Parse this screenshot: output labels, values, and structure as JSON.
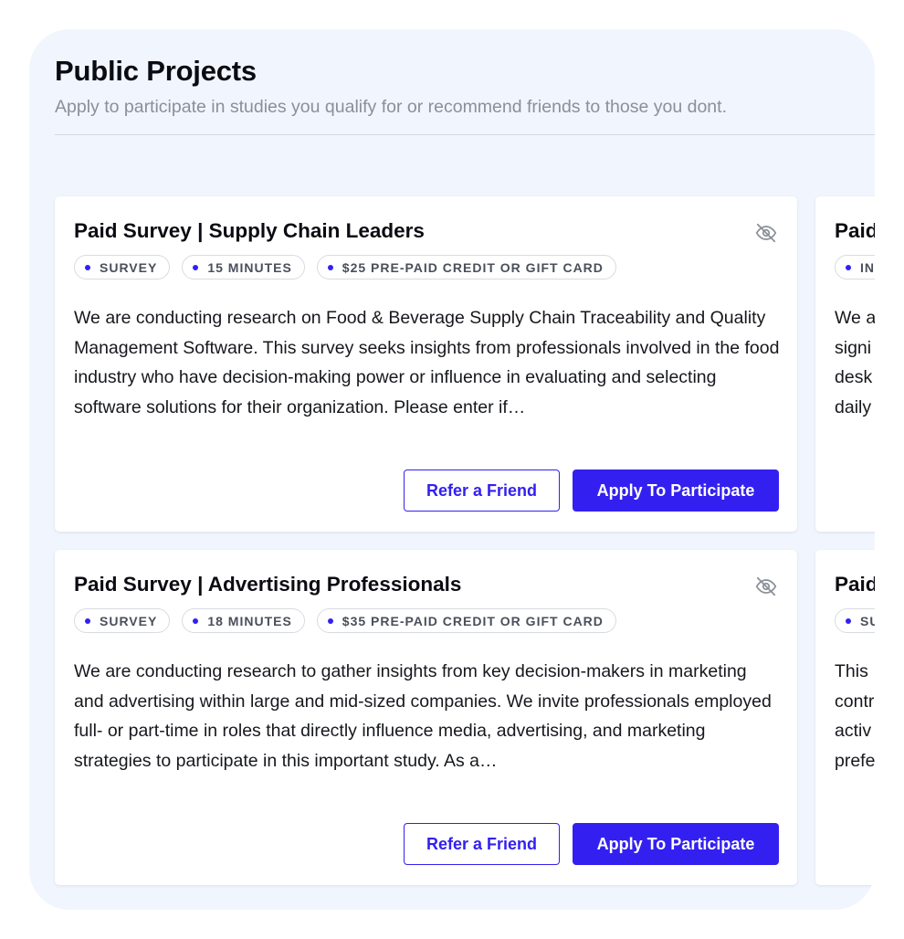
{
  "page": {
    "title": "Public Projects",
    "subtitle": "Apply to participate in studies you qualify for or recommend friends to those you dont."
  },
  "projects": [
    {
      "title": "Paid Survey | Supply Chain Leaders",
      "tags": [
        "SURVEY",
        "15 MINUTES",
        "$25 PRE-PAID CREDIT OR GIFT CARD"
      ],
      "description": "We are conducting research on Food & Beverage Supply Chain Traceability and Quality Management Software. This survey seeks insights from professionals involved in the food industry who have decision-making power or influence in evaluating and selecting software solutions for their organization. Please enter if…",
      "refer_label": "Refer a Friend",
      "apply_label": "Apply To Participate",
      "hide_icon": "eye-slash-icon"
    },
    {
      "title": "Paid Survey | Advertising Professionals",
      "tags": [
        "SURVEY",
        "18 MINUTES",
        "$35 PRE-PAID CREDIT OR GIFT CARD"
      ],
      "description": "We are conducting research to gather insights from key decision-makers in marketing and advertising within large and mid-sized companies. We invite professionals employed full- or part-time in roles that directly influence media, advertising, and marketing strategies to participate in this important study. As a…",
      "refer_label": "Refer a Friend",
      "apply_label": "Apply To Participate",
      "hide_icon": "eye-slash-icon"
    }
  ],
  "peek_cards": [
    {
      "title": "Paid",
      "tag": "IN",
      "lines": [
        "We a",
        "signi",
        "desk",
        "daily"
      ]
    },
    {
      "title": "Paid",
      "tag": "SU",
      "lines": [
        "This",
        "contr",
        "activ",
        "prefe"
      ]
    }
  ],
  "colors": {
    "accent": "#3320f0",
    "panel_bg": "#f1f6fe",
    "card_bg": "#ffffff",
    "muted_text": "#8a8f98"
  }
}
